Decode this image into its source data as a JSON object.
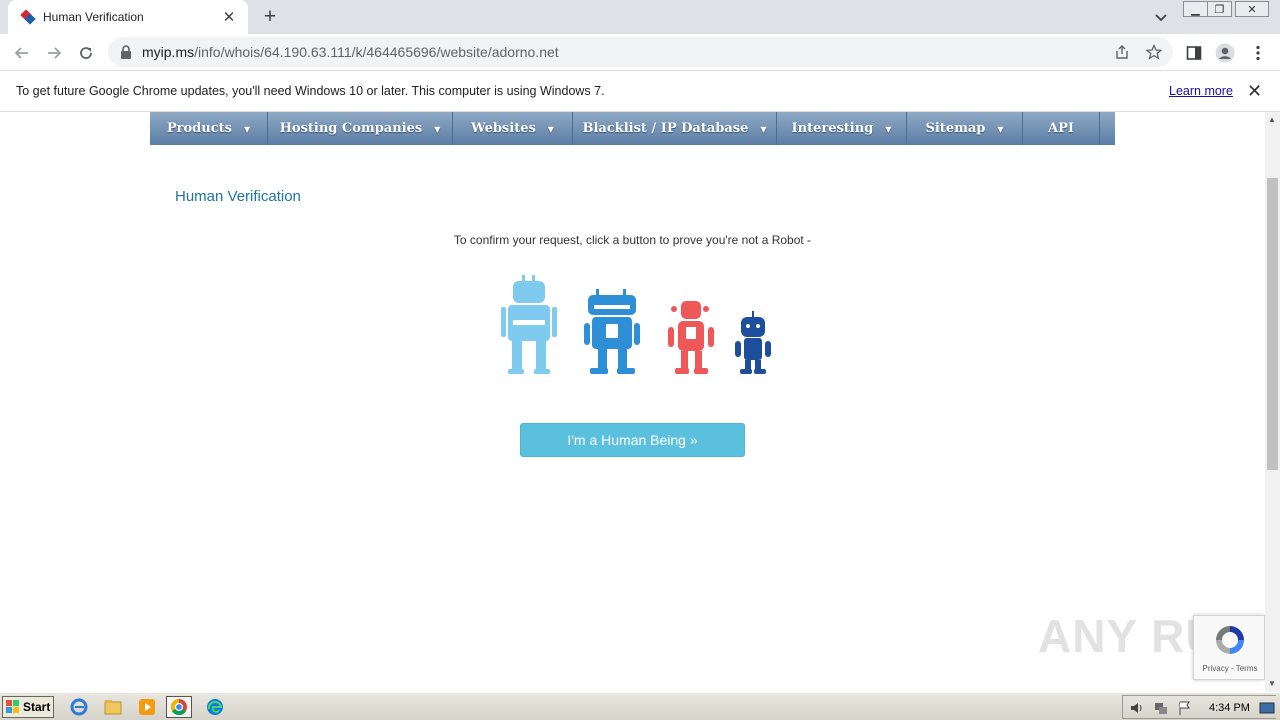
{
  "browser": {
    "tab_title": "Human Verification",
    "url_host": "myip.ms",
    "url_path": "/info/whois/64.190.63.111/k/464465696/website/adorno.net"
  },
  "infobar": {
    "message": "To get future Google Chrome updates, you'll need Windows 10 or later. This computer is using Windows 7.",
    "link": "Learn more"
  },
  "nav": {
    "items": [
      {
        "label": "Products"
      },
      {
        "label": "Hosting Companies"
      },
      {
        "label": "Websites"
      },
      {
        "label": "Blacklist / IP Database"
      },
      {
        "label": "Interesting"
      },
      {
        "label": "Sitemap"
      },
      {
        "label": "API"
      }
    ]
  },
  "page": {
    "title": "Human Verification",
    "subtitle": "To confirm your request, click a button to prove you're not a Robot -",
    "button": "I'm a Human Being »"
  },
  "overlay": {
    "watermark": "ANY RUN",
    "recaptcha_text": "Privacy - Terms"
  },
  "taskbar": {
    "start": "Start",
    "clock": "4:34 PM"
  },
  "colors": {
    "nav_gradient_top": "#8fa8c4",
    "nav_gradient_bottom": "#5b7ea6",
    "title_blue": "#1f74a6",
    "button_bg": "#5bc0de",
    "robot_light_blue": "#7ecbef",
    "robot_blue": "#2f8fd6",
    "robot_red": "#ef5858",
    "robot_navy": "#1d4f9c"
  }
}
